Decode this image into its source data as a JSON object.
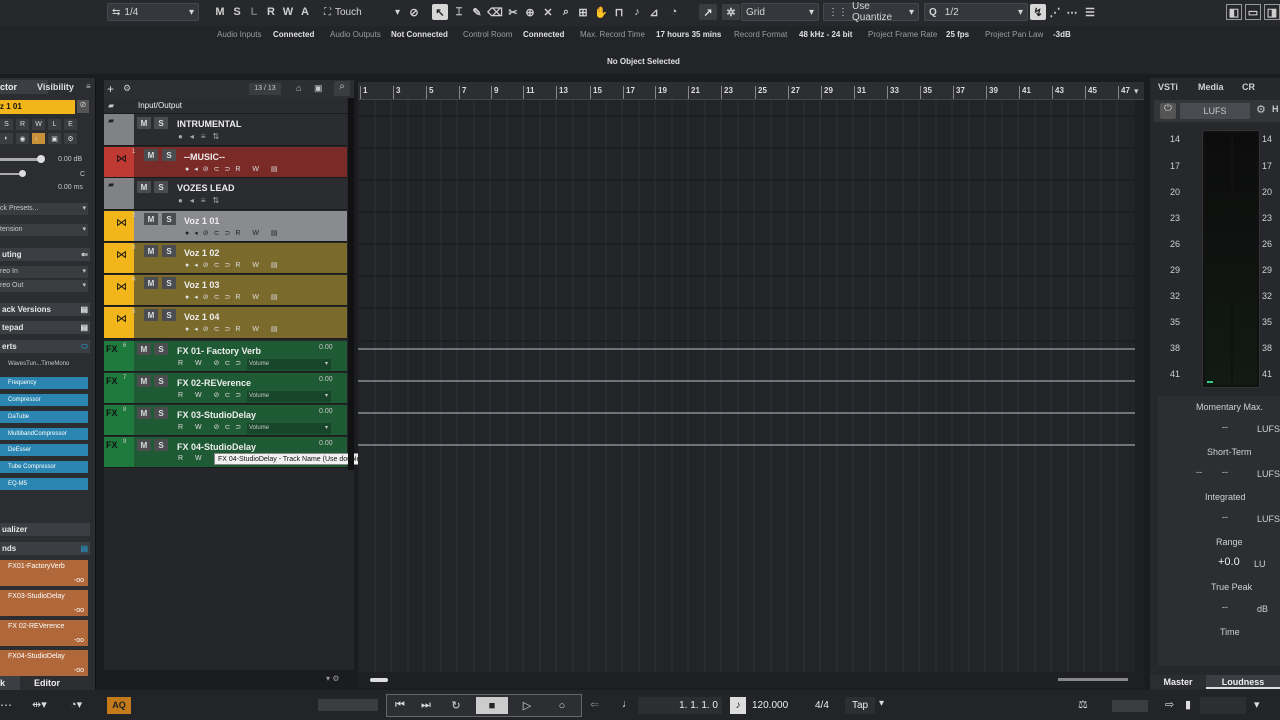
{
  "toolbar": {
    "quantize_value": "1/4",
    "states": [
      "M",
      "S",
      "L",
      "R",
      "W",
      "A"
    ],
    "automation_mode": "Touch",
    "grid_mode": "Grid",
    "quantize_mode": "Use Quantize",
    "grid_value": "1/2"
  },
  "status": {
    "items": [
      {
        "label": "Audio Inputs",
        "value": "Connected"
      },
      {
        "label": "Audio Outputs",
        "value": "Not Connected"
      },
      {
        "label": "Control Room",
        "value": "Connected"
      },
      {
        "label": "Max. Record Time",
        "value": "17 hours 35 mins"
      },
      {
        "label": "Record Format",
        "value": "48 kHz - 24 bit"
      },
      {
        "label": "Project Frame Rate",
        "value": "25 fps"
      },
      {
        "label": "Project Pan Law",
        "value": "-3dB"
      }
    ],
    "info_line": "No Object Selected"
  },
  "inspector": {
    "tab_inspector": "ctor",
    "tab_visibility": "Visibility",
    "track_name": "z 1 01",
    "volume": "0.00 dB",
    "pan": "C",
    "delay": "0.00 ms",
    "presets": "ck Presets...",
    "extension": "tension",
    "routing": "uting",
    "input": "reo In",
    "output": "reo Out",
    "track_versions": "ack Versions",
    "notepad": "tepad",
    "inserts": "erts",
    "insert_first": "WavesTun...TimeMono",
    "plugins": [
      "Frequency",
      "Compressor",
      "DaTube",
      "MultibandCompressor",
      "DeEsser",
      "Tube Compressor",
      "EQ-M5"
    ],
    "equalizer": "ualizer",
    "sends": "nds",
    "send_items": [
      "FX01-FactoryVerb",
      "FX03-StudioDelay",
      "FX 02-REVerence",
      "FX04-StudioDelay"
    ],
    "send_level": "-oo",
    "tab_track": "k",
    "tab_editor": "Editor"
  },
  "tracklist": {
    "count": "13 / 13",
    "tracks": [
      {
        "name": "Input/Output",
        "num": ""
      },
      {
        "name": "INTRUMENTAL",
        "num": ""
      },
      {
        "name": "--MUSIC--",
        "num": "1"
      },
      {
        "name": "VOZES LEAD",
        "num": ""
      },
      {
        "name": "Voz 1 01",
        "num": "2"
      },
      {
        "name": "Voz 1 02",
        "num": "3"
      },
      {
        "name": "Voz 1 03",
        "num": "4"
      },
      {
        "name": "Voz 1 04",
        "num": "5"
      },
      {
        "name": "FX 01- Factory Verb",
        "num": "6",
        "value": "0.00",
        "auto": "Volume"
      },
      {
        "name": "FX 02-REVerence",
        "num": "7",
        "value": "0.00",
        "auto": "Volume"
      },
      {
        "name": "FX 03-StudioDelay",
        "num": "8",
        "value": "0.00",
        "auto": "Volume"
      },
      {
        "name": "FX 04-StudioDelay",
        "num": "9",
        "value": "0.00",
        "auto": "Volume"
      }
    ],
    "tooltip": "FX 04-StudioDelay - Track Name (Use double-click to edit)",
    "fx_label": "FX",
    "btn_m": "M",
    "btn_s": "S",
    "btn_r": "R",
    "btn_w": "W"
  },
  "ruler": {
    "bars": [
      "1",
      "3",
      "5",
      "7",
      "9",
      "11",
      "13",
      "15",
      "17",
      "19",
      "21",
      "23",
      "25",
      "27",
      "29",
      "31",
      "33",
      "35",
      "37",
      "39",
      "41",
      "43",
      "45",
      "47"
    ]
  },
  "rightpanel": {
    "tabs": [
      "VSTi",
      "Media",
      "CR"
    ],
    "meter_label": "LUFS",
    "meter_tab": "H",
    "scale": [
      "14",
      "17",
      "20",
      "23",
      "26",
      "29",
      "32",
      "35",
      "38",
      "41"
    ],
    "momentary_label": "Momentary Max.",
    "momentary_value": "--",
    "momentary_unit": "LUFS",
    "short_label": "Short-Term",
    "short_value": "--",
    "short_value2": "--",
    "short_unit": "LUFS",
    "integrated_label": "Integrated",
    "integrated_value": "--",
    "integrated_unit": "LUFS",
    "range_label": "Range",
    "range_value": "+0.0",
    "range_unit": "LU",
    "truepeak_label": "True Peak",
    "truepeak_value": "--",
    "truepeak_unit": "dB",
    "time_label": "Time",
    "bottom_master": "Master",
    "bottom_loudness": "Loudness"
  },
  "transport": {
    "aq": "AQ",
    "position": "1. 1. 1.  0",
    "tempo": "120.000",
    "signature": "4/4",
    "tap": "Tap"
  },
  "colors": {
    "music": "#c03a34",
    "voz": "#f2b61a",
    "vozbody": "#7a6a2c",
    "fx": "#1f7a3d",
    "fxbody": "#1e5a34",
    "folder": "#808285",
    "accent": "#2a86b0",
    "send": "#b0683a"
  }
}
